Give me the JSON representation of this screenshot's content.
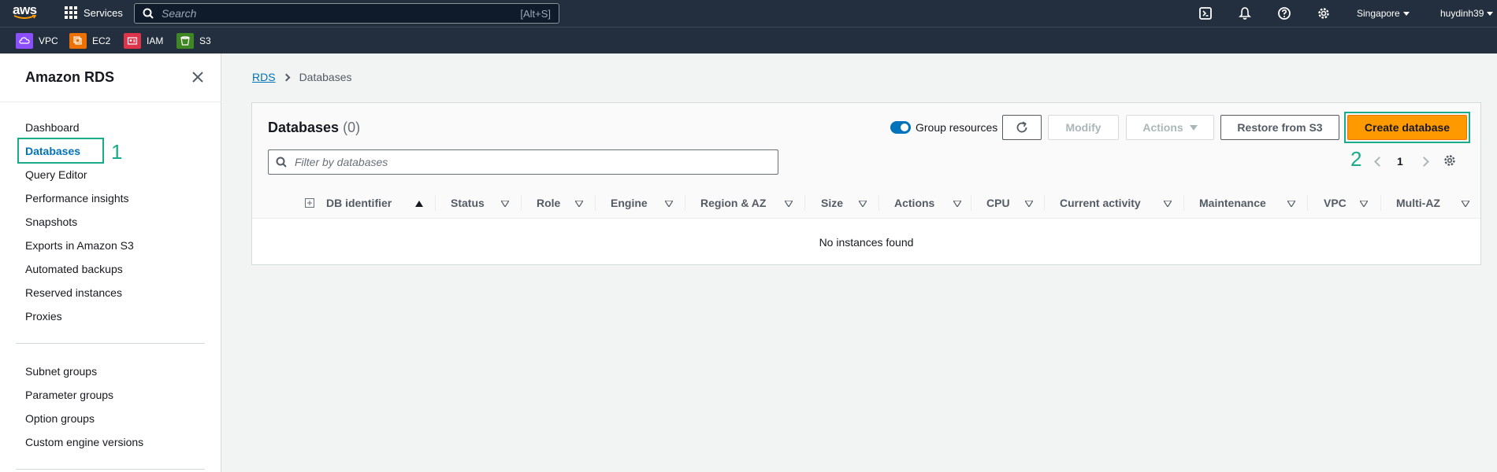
{
  "topnav": {
    "logo": "aws",
    "services_label": "Services",
    "search_placeholder": "Search",
    "search_shortcut": "[Alt+S]",
    "region": "Singapore",
    "user": "huydinh39",
    "icons": [
      "cloudshell-icon",
      "notifications-bell-icon",
      "help-icon",
      "settings-gear-icon"
    ]
  },
  "favorites": [
    {
      "label": "VPC",
      "color": "#8c4fff"
    },
    {
      "label": "EC2",
      "color": "#ed7100"
    },
    {
      "label": "IAM",
      "color": "#dd344c"
    },
    {
      "label": "S3",
      "color": "#3f8624"
    }
  ],
  "sidebar": {
    "title": "Amazon RDS",
    "items": [
      {
        "label": "Dashboard"
      },
      {
        "label": "Databases",
        "active": true
      },
      {
        "label": "Query Editor"
      },
      {
        "label": "Performance insights"
      },
      {
        "label": "Snapshots"
      },
      {
        "label": "Exports in Amazon S3"
      },
      {
        "label": "Automated backups"
      },
      {
        "label": "Reserved instances"
      },
      {
        "label": "Proxies"
      }
    ],
    "items2": [
      {
        "label": "Subnet groups"
      },
      {
        "label": "Parameter groups"
      },
      {
        "label": "Option groups"
      },
      {
        "label": "Custom engine versions"
      }
    ]
  },
  "annotations": {
    "step1": "1",
    "step2": "2",
    "color": "#1aab8a"
  },
  "breadcrumb": {
    "root": "RDS",
    "current": "Databases"
  },
  "panel": {
    "title": "Databases",
    "count": "(0)",
    "group_resources_label": "Group resources",
    "group_resources_on": true,
    "buttons": {
      "modify": "Modify",
      "actions": "Actions",
      "restore": "Restore from S3",
      "create": "Create database"
    },
    "filter_placeholder": "Filter by databases",
    "page": "1",
    "columns": [
      "DB identifier",
      "Status",
      "Role",
      "Engine",
      "Region & AZ",
      "Size",
      "Actions",
      "CPU",
      "Current activity",
      "Maintenance",
      "VPC",
      "Multi-AZ"
    ],
    "empty_message": "No instances found",
    "primary_color": "#ff9900"
  }
}
